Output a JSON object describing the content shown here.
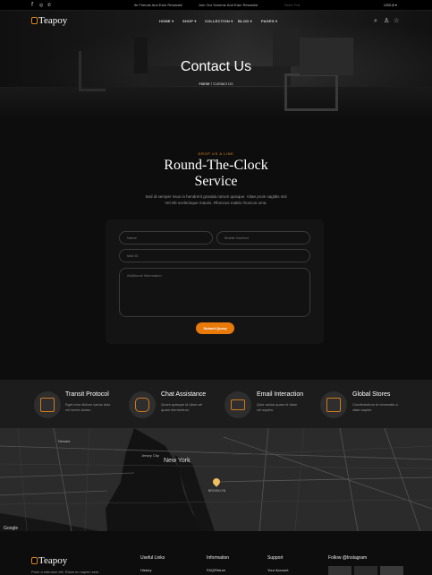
{
  "topbar": {
    "social_icons": [
      "facebook-icon",
      "instagram-icon",
      "whatsapp-icon"
    ],
    "ticker_1": "ite Friends And Earn Rewards!",
    "ticker_2": "Join Our Scheme And Earn Rewards!",
    "ticker_3": "Refer Frie",
    "currency": "USD,$"
  },
  "brand": {
    "name": "Teapoy",
    "accent": "#e8790b"
  },
  "nav": {
    "items": [
      "HOME",
      "SHOP",
      "COLLECTION",
      "BLOG",
      "PAGES"
    ],
    "icons": [
      "search-icon",
      "user-icon",
      "wishlist-icon"
    ]
  },
  "hero": {
    "title": "Contact Us",
    "breadcrumb_home": "Home",
    "breadcrumb_sep": "/",
    "breadcrumb_current": "Contact Us"
  },
  "contact": {
    "eyebrow": "DROP US A LINE",
    "heading_line1": "Round-The-Clock",
    "heading_line2": "Service",
    "desc_line1": "Sed id semper risus in hendrerit gravida rutrum quisque. Vitae proin sagittis nisl",
    "desc_line2": "Vel elit scelerisque mauris. Rhoncus mattis rhoncus urna."
  },
  "form": {
    "name_placeholder": "Name",
    "mobile_placeholder": "Mobile Number",
    "mail_placeholder": "Mail ID",
    "info_placeholder": "Additional Information",
    "submit_label": "Submit Query"
  },
  "features": [
    {
      "title": "Transit Protocol",
      "line1": "Eget eros dictum varius duis",
      "line2": "vel lorem donec.",
      "icon": "document-icon"
    },
    {
      "title": "Chat Assistance",
      "line1": "Quam quisque id diam vel",
      "line2": "quam elementum.",
      "icon": "chat-icon"
    },
    {
      "title": "Email Interaction",
      "line1": "Quis varius quam id diam",
      "line2": "vel sapien.",
      "icon": "envelope-icon"
    },
    {
      "title": "Global Stores",
      "line1": "Condimentum id venenatis a",
      "line2": "vitae sapien.",
      "icon": "store-icon"
    }
  ],
  "map": {
    "labels": {
      "newark": "Newark",
      "jersey_city": "Jersey City",
      "new_york": "New York",
      "brooklyn": "BROOKLYN"
    },
    "pin_icon": "map-pin-icon",
    "google": "Google"
  },
  "footer": {
    "tagline": "Proin a interdum elit. Etiam eu sapien sem.",
    "col1_head": "Useful Links",
    "col1_link": "History",
    "col2_head": "Information",
    "col2_link": "FAQ/Return",
    "col3_head": "Support",
    "col3_link": "Your Account",
    "col4_head": "Follow @Instagram"
  }
}
